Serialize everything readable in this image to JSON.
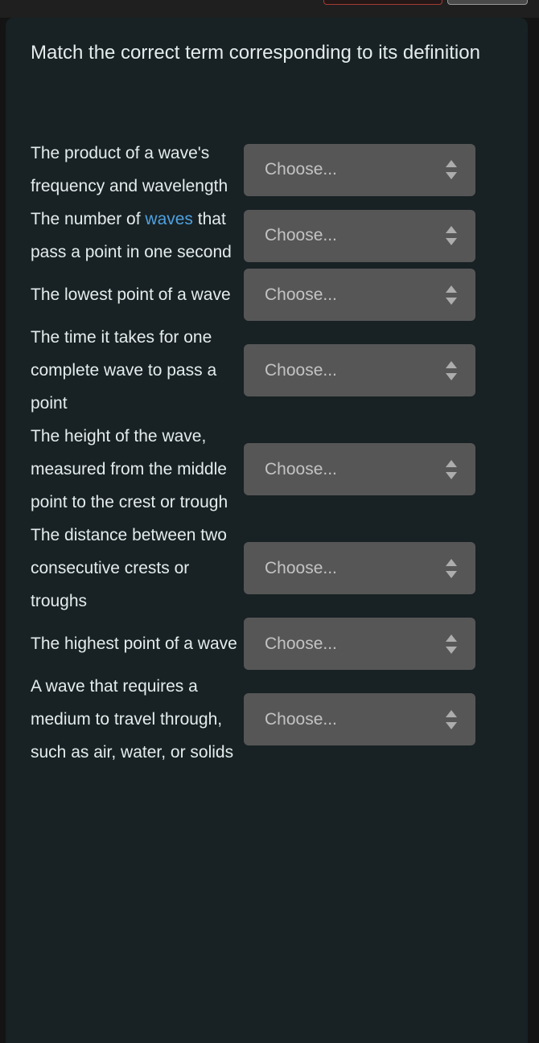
{
  "topbar": {
    "buttons": [
      {
        "name": "danger-button",
        "style": "danger"
      },
      {
        "name": "neutral-button",
        "style": "neutral"
      }
    ]
  },
  "colors": {
    "page_background": "#141414",
    "card_background": "#182124",
    "text": "#e4ecec",
    "link": "#4ea1e0",
    "select_background": "#565656",
    "select_placeholder": "#c3c3c3",
    "danger_border": "#a03c32"
  },
  "page": {
    "title": "Match the correct term corresponding to its definition"
  },
  "select_placeholder": "Choose...",
  "items": [
    {
      "definition_pre": "The product of a wave's frequency and wavelength",
      "link_text": "",
      "definition_post": "",
      "select_value": "Choose..."
    },
    {
      "definition_pre": "The number of ",
      "link_text": "waves",
      "definition_post": " that pass a point in one second",
      "select_value": "Choose..."
    },
    {
      "definition_pre": "The lowest point of a wave",
      "link_text": "",
      "definition_post": "",
      "select_value": "Choose..."
    },
    {
      "definition_pre": "The time it takes for one complete wave to pass a point",
      "link_text": "",
      "definition_post": "",
      "select_value": "Choose..."
    },
    {
      "definition_pre": "The height of the wave, measured from the middle point to the crest or trough",
      "link_text": "",
      "definition_post": "",
      "select_value": "Choose..."
    },
    {
      "definition_pre": "The distance between two consecutive crests or troughs",
      "link_text": "",
      "definition_post": "",
      "select_value": "Choose..."
    },
    {
      "definition_pre": "The highest point of a wave",
      "link_text": "",
      "definition_post": "",
      "select_value": "Choose..."
    },
    {
      "definition_pre": "A wave that requires a medium to travel through, such as air, water, or solids",
      "link_text": "",
      "definition_post": "",
      "select_value": "Choose..."
    }
  ]
}
